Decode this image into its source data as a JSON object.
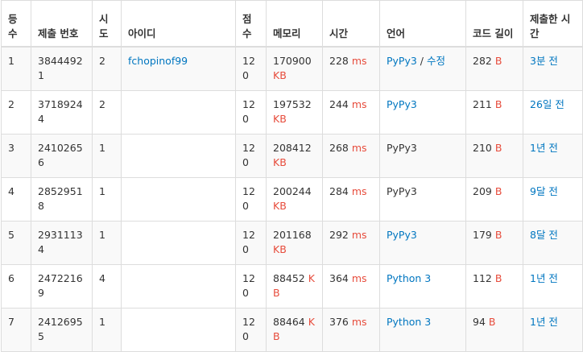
{
  "table": {
    "headers": [
      "등수",
      "제출 번호",
      "시도",
      "아이디",
      "점수",
      "메모리",
      "시간",
      "언어",
      "코드 길이",
      "제출한 시간"
    ],
    "rows": [
      {
        "rank": "1",
        "submit_id": "38444921",
        "tries": "2",
        "user": "fchopinof99",
        "score": "120",
        "memory": "170900",
        "memory_unit": "KB",
        "time": "228",
        "time_unit": "ms",
        "lang": "PyPy3",
        "lang_link": true,
        "lang_sep": " / ",
        "lang_extra": "수정",
        "code_len": "282",
        "code_unit": "B",
        "submitted": "3분 전"
      },
      {
        "rank": "2",
        "submit_id": "37189244",
        "tries": "2",
        "user": "",
        "score": "120",
        "memory": "197532",
        "memory_unit": "KB",
        "time": "244",
        "time_unit": "ms",
        "lang": "PyPy3",
        "lang_link": true,
        "code_len": "211",
        "code_unit": "B",
        "submitted": "26일 전"
      },
      {
        "rank": "3",
        "submit_id": "24102656",
        "tries": "1",
        "user": "",
        "score": "120",
        "memory": "208412",
        "memory_unit": "KB",
        "time": "268",
        "time_unit": "ms",
        "lang": "PyPy3",
        "lang_link": false,
        "code_len": "210",
        "code_unit": "B",
        "submitted": "1년 전"
      },
      {
        "rank": "4",
        "submit_id": "28529518",
        "tries": "1",
        "user": "",
        "score": "120",
        "memory": "200244",
        "memory_unit": "KB",
        "time": "284",
        "time_unit": "ms",
        "lang": "PyPy3",
        "lang_link": false,
        "code_len": "209",
        "code_unit": "B",
        "submitted": "9달 전"
      },
      {
        "rank": "5",
        "submit_id": "29311134",
        "tries": "1",
        "user": "",
        "score": "120",
        "memory": "201168",
        "memory_unit": "KB",
        "time": "292",
        "time_unit": "ms",
        "lang": "PyPy3",
        "lang_link": true,
        "code_len": "179",
        "code_unit": "B",
        "submitted": "8달 전"
      },
      {
        "rank": "6",
        "submit_id": "24722169",
        "tries": "4",
        "user": "",
        "score": "120",
        "memory": "88452",
        "memory_unit": "KB",
        "time": "364",
        "time_unit": "ms",
        "lang": "Python 3",
        "lang_link": true,
        "code_len": "112",
        "code_unit": "B",
        "submitted": "1년 전"
      },
      {
        "rank": "7",
        "submit_id": "24126955",
        "tries": "1",
        "user": "",
        "score": "120",
        "memory": "88464",
        "memory_unit": "KB",
        "time": "376",
        "time_unit": "ms",
        "lang": "Python 3",
        "lang_link": true,
        "code_len": "94",
        "code_unit": "B",
        "submitted": "1년 전"
      }
    ]
  },
  "colors": {
    "link": "#0076c0",
    "unit": "#e74c3c",
    "border": "#dddddd",
    "stripe": "#f9f9f9"
  }
}
